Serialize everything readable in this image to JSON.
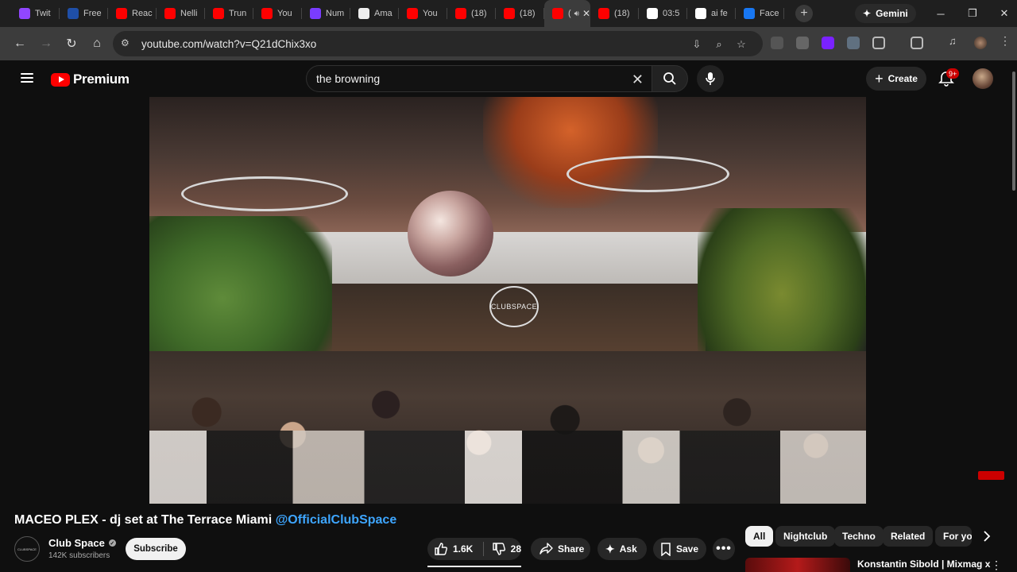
{
  "browser": {
    "tabs": [
      {
        "label": "Twit",
        "icon": "twitch-icon",
        "color": "#9146ff"
      },
      {
        "label": "Free",
        "icon": "j-icon",
        "color": "#1f4fa8"
      },
      {
        "label": "Reac",
        "icon": "youtube-icon",
        "color": "#ff0000"
      },
      {
        "label": "Nelli",
        "icon": "youtube-icon",
        "color": "#ff0000"
      },
      {
        "label": "Trun",
        "icon": "youtube-icon",
        "color": "#ff0000"
      },
      {
        "label": "You",
        "icon": "youtube-icon",
        "color": "#ff0000"
      },
      {
        "label": "Num",
        "icon": "gradient-icon",
        "color": "#7a3cff"
      },
      {
        "label": "Ama",
        "icon": "amazon-icon",
        "color": "#eeeeee"
      },
      {
        "label": "You",
        "icon": "youtube-icon",
        "color": "#ff0000"
      },
      {
        "label": "(18)",
        "icon": "youtube-icon",
        "color": "#ff0000"
      },
      {
        "label": "(18)",
        "icon": "youtube-icon",
        "color": "#ff0000"
      },
      {
        "label": "(",
        "icon": "youtube-icon",
        "color": "#ff0000",
        "active": true
      },
      {
        "label": "(18)",
        "icon": "youtube-icon",
        "color": "#ff0000"
      },
      {
        "label": "03:5",
        "icon": "google-icon",
        "color": "#ffffff"
      },
      {
        "label": "ai fe",
        "icon": "google-icon",
        "color": "#ffffff"
      },
      {
        "label": "Face",
        "icon": "facebook-icon",
        "color": "#1877f2"
      }
    ],
    "gemini_label": "Gemini",
    "url": "youtube.com/watch?v=Q21dChix3xo"
  },
  "yt": {
    "logo_word": "Premium",
    "search_value": "the browning",
    "create_label": "Create",
    "notif_badge": "9+"
  },
  "video": {
    "venue_sign": "CLUBSPACE",
    "title": "MACEO PLEX - dj set at The Terrace Miami",
    "title_handle": "@OfficialClubSpace",
    "channel_name": "Club Space",
    "channel_avatar_text": "CLUBSPACE",
    "subscribers": "142K subscribers",
    "subscribe_label": "Subscribe",
    "likes": "1.6K",
    "dislikes": "28",
    "share_label": "Share",
    "ask_label": "Ask",
    "save_label": "Save"
  },
  "chips": [
    "All",
    "Nightclub",
    "Techno",
    "Related",
    "For yo"
  ],
  "recommendation": {
    "title": "Konstantin Sibold | Mixmag x"
  }
}
